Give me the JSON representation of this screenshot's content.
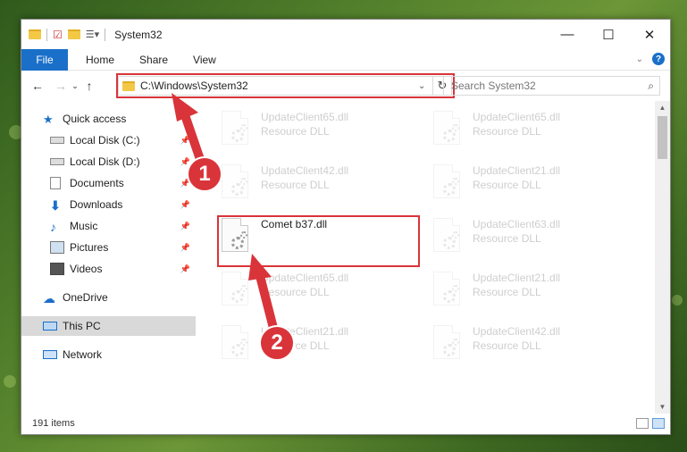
{
  "window": {
    "title": "System32"
  },
  "controls": {
    "minimize": "—",
    "maximize": "☐",
    "close": "✕"
  },
  "ribbon": {
    "tabs": [
      "File",
      "Home",
      "Share",
      "View"
    ]
  },
  "address": {
    "path": "C:\\Windows\\System32"
  },
  "search": {
    "placeholder": "Search System32"
  },
  "sidebar": {
    "items": [
      {
        "label": "Quick access",
        "icon": "star-icon"
      },
      {
        "label": "Local Disk (C:)",
        "icon": "drive-icon"
      },
      {
        "label": "Local Disk (D:)",
        "icon": "drive-icon"
      },
      {
        "label": "Documents",
        "icon": "documents-icon"
      },
      {
        "label": "Downloads",
        "icon": "download-icon"
      },
      {
        "label": "Music",
        "icon": "music-icon"
      },
      {
        "label": "Pictures",
        "icon": "pictures-icon"
      },
      {
        "label": "Videos",
        "icon": "videos-icon"
      },
      {
        "label": "OneDrive",
        "icon": "cloud-icon"
      },
      {
        "label": "This PC",
        "icon": "computer-icon"
      },
      {
        "label": "Network",
        "icon": "network-icon"
      }
    ]
  },
  "files": [
    {
      "name": "UpdateClient65.dll",
      "type": "Resource DLL"
    },
    {
      "name": "UpdateClient65.dll",
      "type": "Resource DLL"
    },
    {
      "name": "UpdateClient42.dll",
      "type": "Resource DLL"
    },
    {
      "name": "UpdateClient21.dll",
      "type": "Resource DLL"
    },
    {
      "name": "Comet b37.dll",
      "type": ""
    },
    {
      "name": "UpdateClient63.dll",
      "type": "Resource DLL"
    },
    {
      "name": "UpdateClient65.dll",
      "type": "Resource DLL"
    },
    {
      "name": "UpdateClient21.dll",
      "type": "Resource DLL"
    },
    {
      "name": "UpdateClient21.dll",
      "type": "Resource DLL"
    },
    {
      "name": "UpdateClient42.dll",
      "type": "Resource DLL"
    }
  ],
  "status": {
    "count": "191 items"
  },
  "annotations": {
    "step1": "1",
    "step2": "2"
  },
  "colors": {
    "highlight": "#d9343a",
    "accent": "#1a6fc9"
  }
}
